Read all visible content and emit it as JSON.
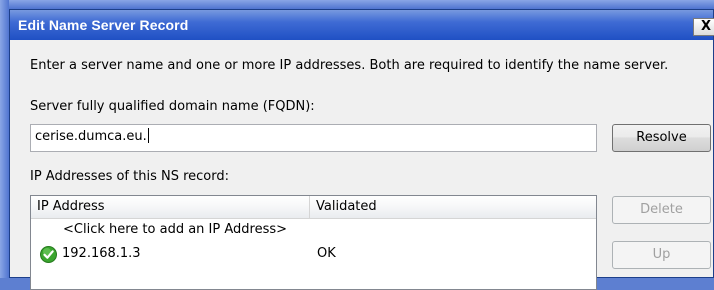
{
  "window": {
    "title": "Edit Name Server Record",
    "close_glyph": "X"
  },
  "labels": {
    "intro": "Enter a server name and one or more IP addresses.  Both are required to identify the name server.",
    "fqdn": "Server fully qualified domain name (FQDN):",
    "ns_addresses": "IP Addresses of this NS record:"
  },
  "fqdn_input": {
    "value": "cerise.dumca.eu."
  },
  "buttons": {
    "resolve": "Resolve",
    "delete": "Delete",
    "up": "Up"
  },
  "ip_list": {
    "columns": [
      "IP Address",
      "Validated"
    ],
    "add_prompt": "<Click here to add an IP Address>",
    "rows": [
      {
        "ip": "192.168.1.3",
        "validated": "OK",
        "status_icon": "check-icon"
      }
    ]
  },
  "colors": {
    "titlebar": "#3f6bd4",
    "ok_green": "#3aa52e"
  }
}
